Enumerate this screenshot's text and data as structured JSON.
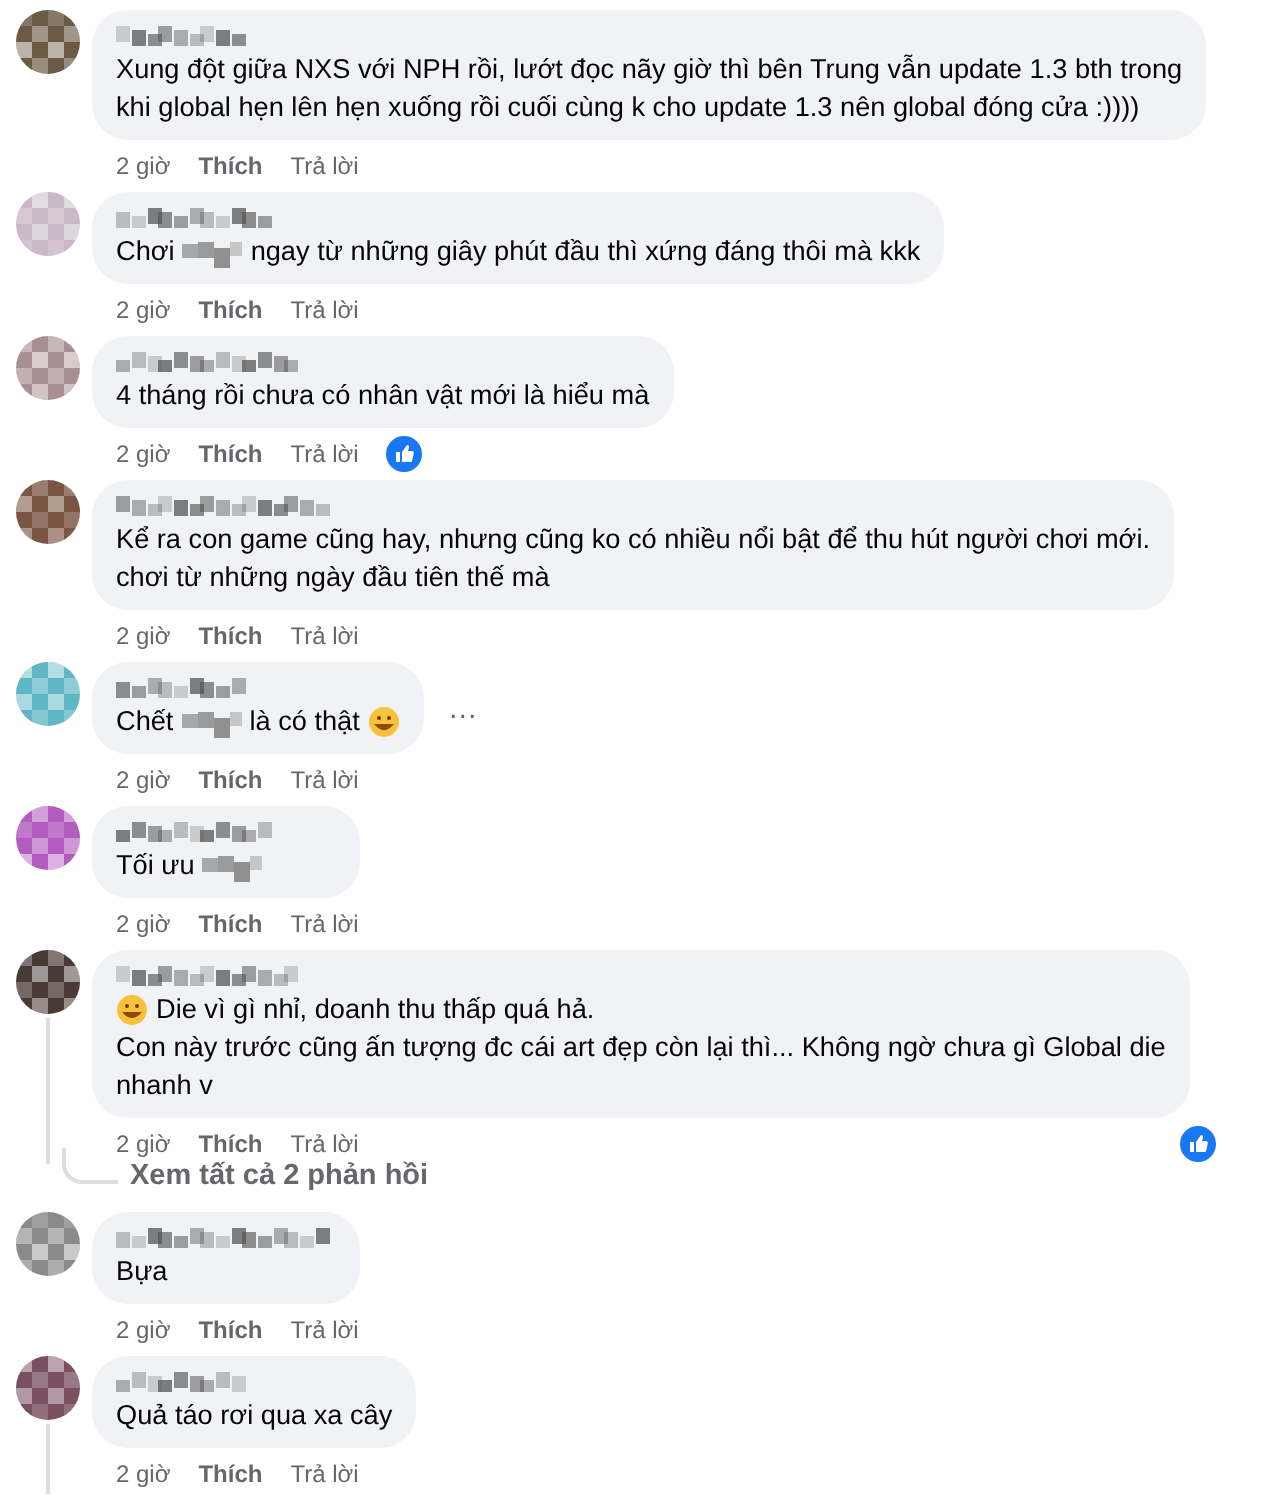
{
  "comments": [
    {
      "avatar": {
        "color": "#6b5a44"
      },
      "lines": [
        [
          {
            "kind": "text",
            "text": "Xung đột giữa NXS với NPH rồi, lướt đọc nãy giờ thì bên Trung vẫn update 1.3 bth trong"
          }
        ],
        [
          {
            "kind": "text",
            "text": "khi global hẹn lên hẹn xuống rồi cuối cùng k cho update 1.3 nên global đóng cửa :))))"
          }
        ]
      ],
      "time": "2 giờ",
      "like": "Thích",
      "reply": "Trả lời"
    },
    {
      "avatar": {
        "color": "#c9b8c8"
      },
      "lines": [
        [
          {
            "kind": "text",
            "text": "Chơi"
          },
          {
            "kind": "censored"
          },
          {
            "kind": "text",
            "text": "ngay từ những giây phút đầu thì xứng đáng thôi mà kkk"
          }
        ]
      ],
      "time": "2 giờ",
      "like": "Thích",
      "reply": "Trả lời"
    },
    {
      "avatar": {
        "color": "#a88f92"
      },
      "lines": [
        [
          {
            "kind": "text",
            "text": "4 tháng rồi chưa có nhân vật mới là hiểu mà"
          }
        ]
      ],
      "time": "2 giờ",
      "like": "Thích",
      "reply": "Trả lời",
      "reaction": {
        "kind": "inline"
      }
    },
    {
      "avatar": {
        "color": "#7a5544"
      },
      "lines": [
        [
          {
            "kind": "text",
            "text": "Kể ra con game cũng hay, nhưng cũng ko có nhiều nổi bật để thu hút người chơi mới."
          }
        ],
        [
          {
            "kind": "text",
            "text": "chơi từ những ngày đầu tiên thế mà"
          }
        ]
      ],
      "time": "2 giờ",
      "like": "Thích",
      "reply": "Trả lời"
    },
    {
      "avatar": {
        "color": "#5fb6c4"
      },
      "lines": [
        [
          {
            "kind": "text",
            "text": "Chết"
          },
          {
            "kind": "censored"
          },
          {
            "kind": "text",
            "text": "là có thật"
          },
          {
            "kind": "emoji"
          }
        ]
      ],
      "time": "2 giờ",
      "like": "Thích",
      "reply": "Trả lời",
      "menu": "…"
    },
    {
      "avatar": {
        "color": "#b35cbf"
      },
      "lines": [
        [
          {
            "kind": "text",
            "text": "Tối ưu"
          },
          {
            "kind": "censored"
          }
        ]
      ],
      "time": "2 giờ",
      "like": "Thích",
      "reply": "Trả lời"
    },
    {
      "avatar": {
        "color": "#4a3a36"
      },
      "lines": [
        [
          {
            "kind": "emoji"
          },
          {
            "kind": "text",
            "text": "Die vì gì nhỉ, doanh thu thấp quá hả."
          }
        ],
        [
          {
            "kind": "text",
            "text": "Con này trước cũng ấn tượng đc cái art đẹp còn lại thì... Không ngờ chưa gì Global die"
          }
        ],
        [
          {
            "kind": "text",
            "text": "nhanh v"
          }
        ]
      ],
      "time": "2 giờ",
      "like": "Thích",
      "reply": "Trả lời",
      "reaction": {
        "kind": "right"
      },
      "thread_line": true,
      "replies_link": "Xem tất cả 2 phản hồi"
    },
    {
      "avatar": {
        "color": "#8a8a8a"
      },
      "lines": [
        [
          {
            "kind": "text",
            "text": "Bựa"
          }
        ]
      ],
      "time": "2 giờ",
      "like": "Thích",
      "reply": "Trả lời"
    },
    {
      "avatar": {
        "color": "#7a4f60"
      },
      "lines": [
        [
          {
            "kind": "text",
            "text": "Quả táo rơi qua xa cây"
          }
        ]
      ],
      "time": "2 giờ",
      "like": "Thích",
      "reply": "Trả lời",
      "thread_line": true
    }
  ]
}
